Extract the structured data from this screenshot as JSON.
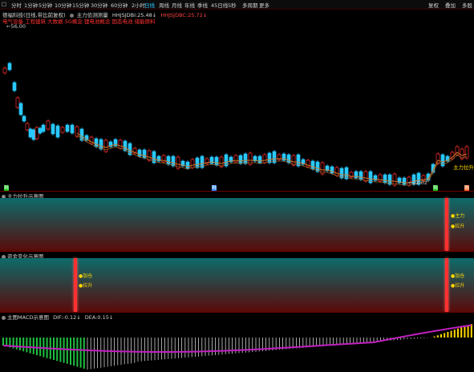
{
  "toolbar": {
    "left_items": [
      {
        "label": "□",
        "active": false
      },
      {
        "label": "分时",
        "active": false
      },
      {
        "label": "1分钟",
        "active": false
      },
      {
        "label": "5分钟",
        "active": false
      },
      {
        "label": "10分钟",
        "active": false
      },
      {
        "label": "15分钟",
        "active": false
      },
      {
        "label": "30分钟",
        "active": false
      },
      {
        "label": "60分钟",
        "active": false
      },
      {
        "label": "2小时",
        "active": false
      },
      {
        "label": "日线",
        "active": true
      },
      {
        "label": "周线",
        "active": false
      },
      {
        "label": "月线",
        "active": false
      },
      {
        "label": "年线",
        "active": false
      },
      {
        "label": "季线",
        "active": false
      },
      {
        "label": "45日线",
        "active": false
      },
      {
        "label": "5秒",
        "active": false
      },
      {
        "label": "多周期",
        "active": false
      },
      {
        "label": "更多",
        "active": false
      }
    ],
    "right_items": [
      "复权",
      "叠加",
      "多股"
    ]
  },
  "main_header": {
    "stock_name": "德福科技(日线,带比前复权)",
    "indicator_name": "主力侦测测量",
    "hhjsjdbi_label": "HHJSJDBI:",
    "hhjsjdbi_value": "25.48",
    "hhjsjdbc_label": "HHJSJDBC:",
    "hhjsjdbc_value": "25.72",
    "second_row": "电气设备 工程建筑 大数据 5G概念 锂电池概念 固态电池 储能原料"
  },
  "main_chart": {
    "price_high_label": "56.00",
    "price_low_label": "22.02",
    "annotation_label": "主力拉升",
    "bottom_markers": [
      {
        "text": "融",
        "color": "#00c000"
      },
      {
        "text": "融",
        "color": "#2080ff"
      },
      {
        "text": "融",
        "color": "#00c000"
      },
      {
        "text": "融",
        "color": "#ff6020"
      }
    ]
  },
  "panel2": {
    "title": "主力拉升示意图",
    "legend": [
      "主力",
      "拉升"
    ]
  },
  "panel3": {
    "title": "资金变化示意图",
    "legend_left": [
      "加仓",
      "拉升"
    ],
    "legend_right": [
      "加仓",
      "拉升"
    ]
  },
  "panel4": {
    "title": "主图MACD示意图",
    "dif_label": "DIF:",
    "dif_value": "-0.12",
    "dea_label": "DEA:",
    "dea_value": "0.15"
  },
  "colors": {
    "up": "#ff3030",
    "down": "#29c9ff",
    "ma": "#c87828",
    "accent": "#29c9ff"
  }
}
